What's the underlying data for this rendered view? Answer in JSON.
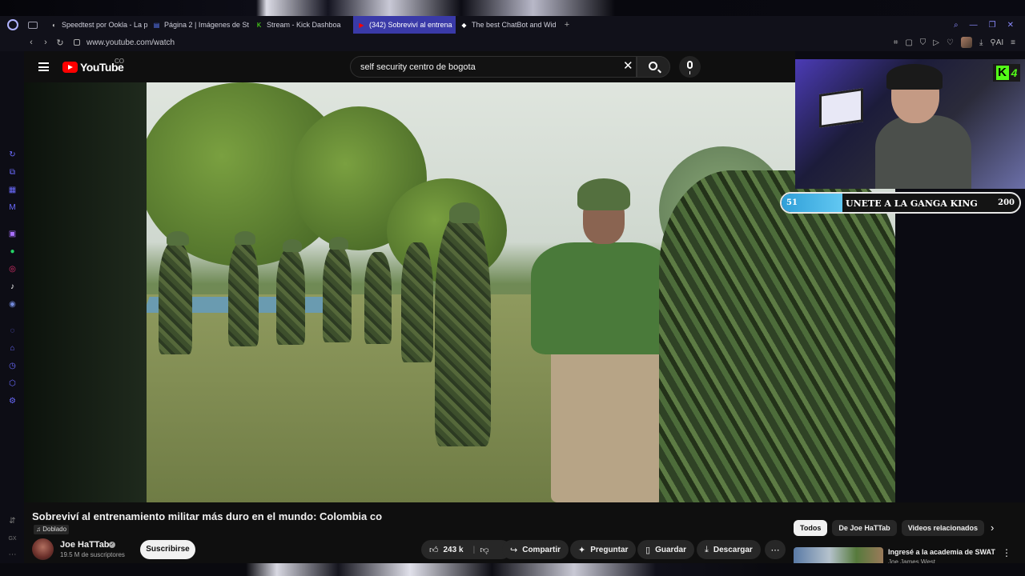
{
  "browser": {
    "tabs": [
      {
        "label": "Speedtest por Ookla - La p",
        "fav": "◐",
        "favcolor": "#cccccc",
        "active": false
      },
      {
        "label": "Página 2 | Imágenes de St",
        "fav": "▤",
        "favcolor": "#5b7cff",
        "active": false
      },
      {
        "label": "Stream - Kick Dashboa",
        "fav": "K",
        "favcolor": "#53fc18",
        "active": false
      },
      {
        "label": "(342) Sobreviví al entrena",
        "fav": "▶",
        "favcolor": "#ff0000",
        "active": true
      },
      {
        "label": "The best ChatBot and Wid",
        "fav": "◆",
        "favcolor": "#ffffff",
        "active": false
      }
    ],
    "new_tab_label": "+",
    "url": "www.youtube.com/watch",
    "ai_label": "AI"
  },
  "youtube": {
    "logo_text": "YouTube",
    "country_code": "CO",
    "search_value": "self security centro de bogota",
    "video": {
      "title": "Sobreviví al entrenamiento militar más duro en el mundo: Colombia co",
      "dub_label": "Doblado",
      "channel_name": "Joe HaTTab",
      "channel_subs": "19.5 M de suscriptores",
      "subscribe_label": "Suscribirse",
      "likes": "243 k",
      "share_label": "Compartir",
      "ask_label": "Preguntar",
      "save_label": "Guardar",
      "download_label": "Descargar"
    },
    "chips": [
      "Todos",
      "De Joe HaTTab",
      "Videos relacionados"
    ],
    "related": {
      "title": "Ingresé a la academia de SWAT",
      "channel": "Joe James West"
    }
  },
  "stream_overlay": {
    "kick_number": "4",
    "goal": {
      "current": "51",
      "title": "UNETE A LA GANGA KING",
      "target": "200",
      "progress": 0.255
    }
  },
  "colors": {
    "accent": "#3a3aa8",
    "kick_green": "#53fc18",
    "youtube_red": "#ff0000",
    "goal_fill": "#3fb0e4"
  }
}
